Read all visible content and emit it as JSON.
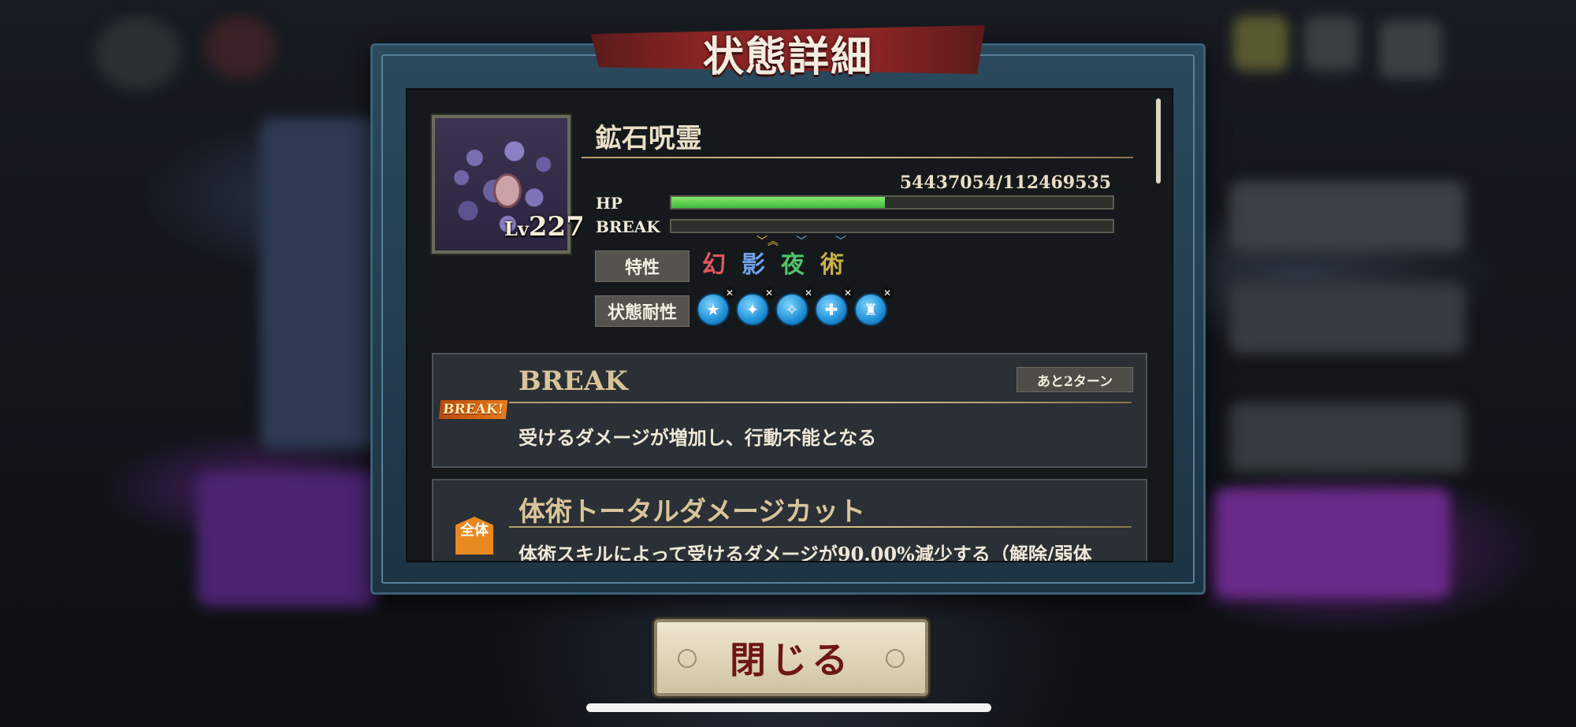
{
  "dialog": {
    "title": "状態詳細"
  },
  "enemy": {
    "name": "鉱石呪霊",
    "level_prefix": "Lv",
    "level": "227",
    "hp_text": "54437054/112469535",
    "hp_fraction": 0.484,
    "break_fraction": 0.0
  },
  "labels": {
    "hp": "HP",
    "break": "BREAK",
    "traits": "特性",
    "resistances": "状態耐性"
  },
  "traits": [
    {
      "char": "幻",
      "color": "#e2585d",
      "chevrons": "",
      "chev_color": ""
    },
    {
      "char": "影",
      "color": "#6fa3e6",
      "chevrons": "﹀︽",
      "chev_color": "#f0c23c"
    },
    {
      "char": "夜",
      "color": "#51c36a",
      "chevrons": "﹀",
      "chev_color": "#6fb6f0"
    },
    {
      "char": "術",
      "color": "#c9b04a",
      "chevrons": "﹀",
      "chev_color": "#6fb6f0"
    }
  ],
  "resist_icons": [
    "status-resist-icon-1",
    "status-resist-icon-2",
    "status-resist-icon-3",
    "status-resist-icon-4",
    "status-resist-icon-5"
  ],
  "effects": [
    {
      "name": "BREAK",
      "badge": "BREAK!",
      "turns": "あと2ターン",
      "desc": "受けるダメージが増加し、行動不能となる"
    },
    {
      "name": "体術トータルダメージカット",
      "badge": "全体",
      "desc": "体術スキルによって受けるダメージが90.00%減少する（解除/弱体"
    }
  ],
  "buttons": {
    "close": "閉じる"
  }
}
